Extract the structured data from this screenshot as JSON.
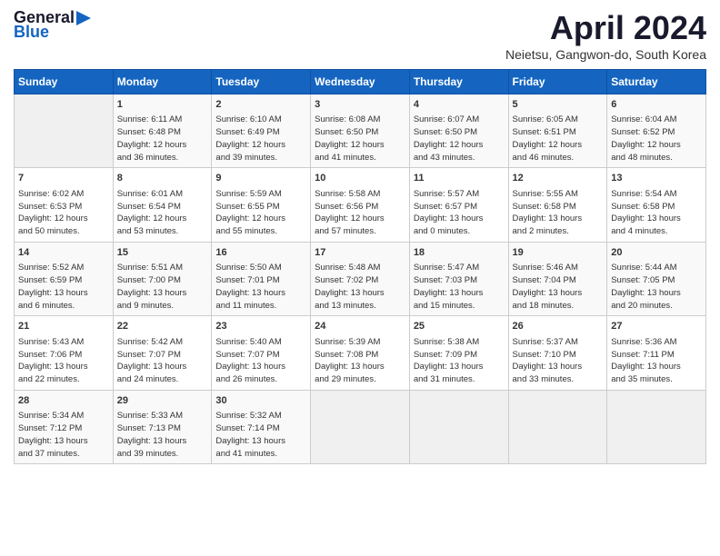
{
  "header": {
    "logo_line1": "General",
    "logo_line2": "Blue",
    "title": "April 2024",
    "location": "Neietsu, Gangwon-do, South Korea"
  },
  "days_of_week": [
    "Sunday",
    "Monday",
    "Tuesday",
    "Wednesday",
    "Thursday",
    "Friday",
    "Saturday"
  ],
  "weeks": [
    [
      {
        "day": "",
        "info": ""
      },
      {
        "day": "1",
        "info": "Sunrise: 6:11 AM\nSunset: 6:48 PM\nDaylight: 12 hours\nand 36 minutes."
      },
      {
        "day": "2",
        "info": "Sunrise: 6:10 AM\nSunset: 6:49 PM\nDaylight: 12 hours\nand 39 minutes."
      },
      {
        "day": "3",
        "info": "Sunrise: 6:08 AM\nSunset: 6:50 PM\nDaylight: 12 hours\nand 41 minutes."
      },
      {
        "day": "4",
        "info": "Sunrise: 6:07 AM\nSunset: 6:50 PM\nDaylight: 12 hours\nand 43 minutes."
      },
      {
        "day": "5",
        "info": "Sunrise: 6:05 AM\nSunset: 6:51 PM\nDaylight: 12 hours\nand 46 minutes."
      },
      {
        "day": "6",
        "info": "Sunrise: 6:04 AM\nSunset: 6:52 PM\nDaylight: 12 hours\nand 48 minutes."
      }
    ],
    [
      {
        "day": "7",
        "info": "Sunrise: 6:02 AM\nSunset: 6:53 PM\nDaylight: 12 hours\nand 50 minutes."
      },
      {
        "day": "8",
        "info": "Sunrise: 6:01 AM\nSunset: 6:54 PM\nDaylight: 12 hours\nand 53 minutes."
      },
      {
        "day": "9",
        "info": "Sunrise: 5:59 AM\nSunset: 6:55 PM\nDaylight: 12 hours\nand 55 minutes."
      },
      {
        "day": "10",
        "info": "Sunrise: 5:58 AM\nSunset: 6:56 PM\nDaylight: 12 hours\nand 57 minutes."
      },
      {
        "day": "11",
        "info": "Sunrise: 5:57 AM\nSunset: 6:57 PM\nDaylight: 13 hours\nand 0 minutes."
      },
      {
        "day": "12",
        "info": "Sunrise: 5:55 AM\nSunset: 6:58 PM\nDaylight: 13 hours\nand 2 minutes."
      },
      {
        "day": "13",
        "info": "Sunrise: 5:54 AM\nSunset: 6:58 PM\nDaylight: 13 hours\nand 4 minutes."
      }
    ],
    [
      {
        "day": "14",
        "info": "Sunrise: 5:52 AM\nSunset: 6:59 PM\nDaylight: 13 hours\nand 6 minutes."
      },
      {
        "day": "15",
        "info": "Sunrise: 5:51 AM\nSunset: 7:00 PM\nDaylight: 13 hours\nand 9 minutes."
      },
      {
        "day": "16",
        "info": "Sunrise: 5:50 AM\nSunset: 7:01 PM\nDaylight: 13 hours\nand 11 minutes."
      },
      {
        "day": "17",
        "info": "Sunrise: 5:48 AM\nSunset: 7:02 PM\nDaylight: 13 hours\nand 13 minutes."
      },
      {
        "day": "18",
        "info": "Sunrise: 5:47 AM\nSunset: 7:03 PM\nDaylight: 13 hours\nand 15 minutes."
      },
      {
        "day": "19",
        "info": "Sunrise: 5:46 AM\nSunset: 7:04 PM\nDaylight: 13 hours\nand 18 minutes."
      },
      {
        "day": "20",
        "info": "Sunrise: 5:44 AM\nSunset: 7:05 PM\nDaylight: 13 hours\nand 20 minutes."
      }
    ],
    [
      {
        "day": "21",
        "info": "Sunrise: 5:43 AM\nSunset: 7:06 PM\nDaylight: 13 hours\nand 22 minutes."
      },
      {
        "day": "22",
        "info": "Sunrise: 5:42 AM\nSunset: 7:07 PM\nDaylight: 13 hours\nand 24 minutes."
      },
      {
        "day": "23",
        "info": "Sunrise: 5:40 AM\nSunset: 7:07 PM\nDaylight: 13 hours\nand 26 minutes."
      },
      {
        "day": "24",
        "info": "Sunrise: 5:39 AM\nSunset: 7:08 PM\nDaylight: 13 hours\nand 29 minutes."
      },
      {
        "day": "25",
        "info": "Sunrise: 5:38 AM\nSunset: 7:09 PM\nDaylight: 13 hours\nand 31 minutes."
      },
      {
        "day": "26",
        "info": "Sunrise: 5:37 AM\nSunset: 7:10 PM\nDaylight: 13 hours\nand 33 minutes."
      },
      {
        "day": "27",
        "info": "Sunrise: 5:36 AM\nSunset: 7:11 PM\nDaylight: 13 hours\nand 35 minutes."
      }
    ],
    [
      {
        "day": "28",
        "info": "Sunrise: 5:34 AM\nSunset: 7:12 PM\nDaylight: 13 hours\nand 37 minutes."
      },
      {
        "day": "29",
        "info": "Sunrise: 5:33 AM\nSunset: 7:13 PM\nDaylight: 13 hours\nand 39 minutes."
      },
      {
        "day": "30",
        "info": "Sunrise: 5:32 AM\nSunset: 7:14 PM\nDaylight: 13 hours\nand 41 minutes."
      },
      {
        "day": "",
        "info": ""
      },
      {
        "day": "",
        "info": ""
      },
      {
        "day": "",
        "info": ""
      },
      {
        "day": "",
        "info": ""
      }
    ]
  ]
}
